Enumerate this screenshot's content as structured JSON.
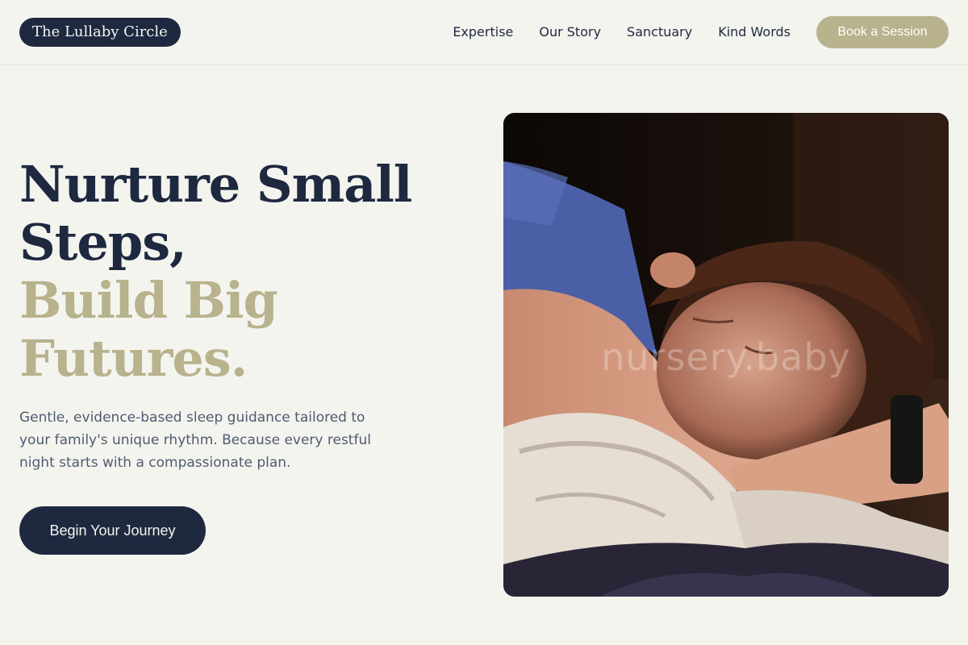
{
  "header": {
    "logo": "The Lullaby Circle",
    "nav": [
      "Expertise",
      "Our Story",
      "Sanctuary",
      "Kind Words"
    ],
    "cta": "Book a Session"
  },
  "hero": {
    "headline_line1": "Nurture Small",
    "headline_line2": "Steps,",
    "headline_line3": "Build Big",
    "headline_line4": "Futures.",
    "subtext": "Gentle, evidence-based sleep guidance tailored to your family's unique rhythm. Because every restful night starts with a compassionate plan.",
    "cta": "Begin Your Journey",
    "image_watermark": "nursery.baby"
  },
  "colors": {
    "navy": "#1e2940",
    "accent": "#b8b28d",
    "background": "#f4f4ef"
  }
}
